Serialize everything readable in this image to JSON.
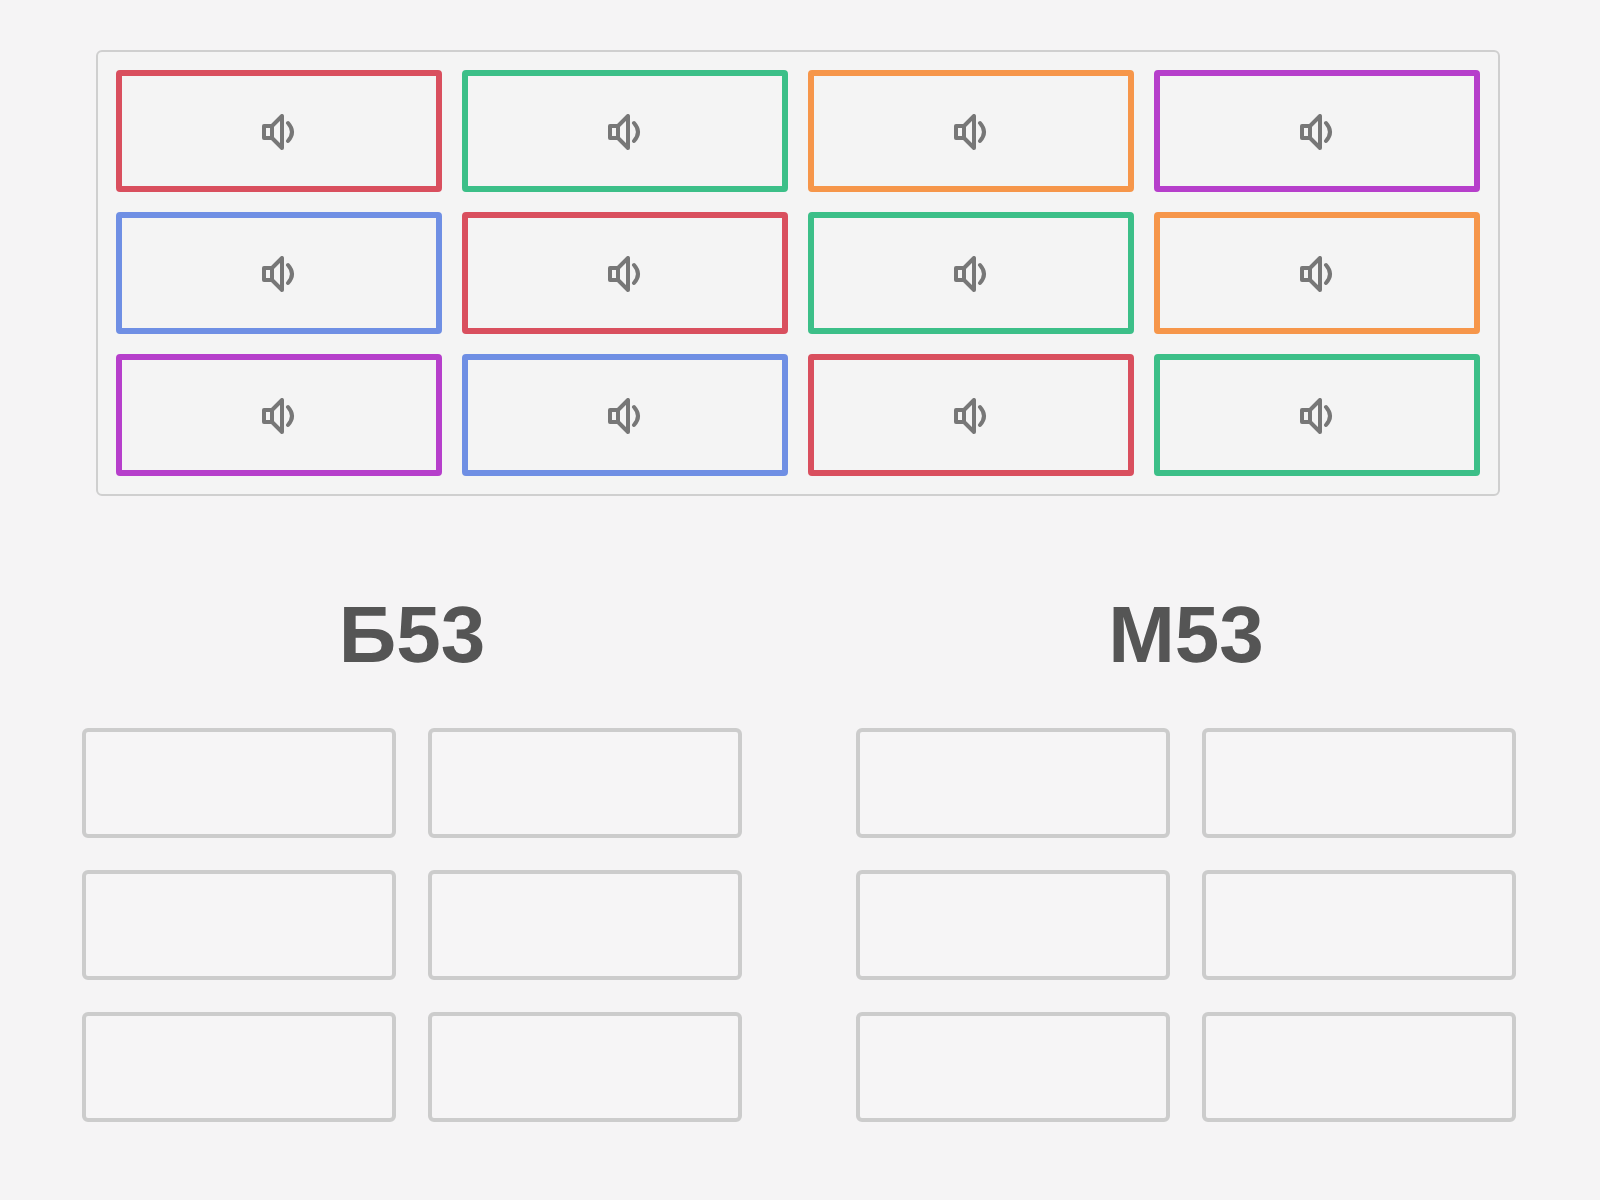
{
  "tiles": [
    {
      "color": "#d94f5e"
    },
    {
      "color": "#3cbf88"
    },
    {
      "color": "#f6964a"
    },
    {
      "color": "#b63fcb"
    },
    {
      "color": "#6f8fe4"
    },
    {
      "color": "#d94f5e"
    },
    {
      "color": "#3cbf88"
    },
    {
      "color": "#f6964a"
    },
    {
      "color": "#b63fcb"
    },
    {
      "color": "#6f8fe4"
    },
    {
      "color": "#d94f5e"
    },
    {
      "color": "#3cbf88"
    }
  ],
  "groups": [
    {
      "title": "Б53",
      "slots": [
        {
          "filled": false
        },
        {
          "filled": false
        },
        {
          "filled": false
        },
        {
          "filled": false
        },
        {
          "filled": false
        },
        {
          "filled": false
        }
      ]
    },
    {
      "title": "М53",
      "slots": [
        {
          "filled": false
        },
        {
          "filled": false
        },
        {
          "filled": false
        },
        {
          "filled": false
        },
        {
          "filled": false
        },
        {
          "filled": false
        }
      ]
    }
  ]
}
